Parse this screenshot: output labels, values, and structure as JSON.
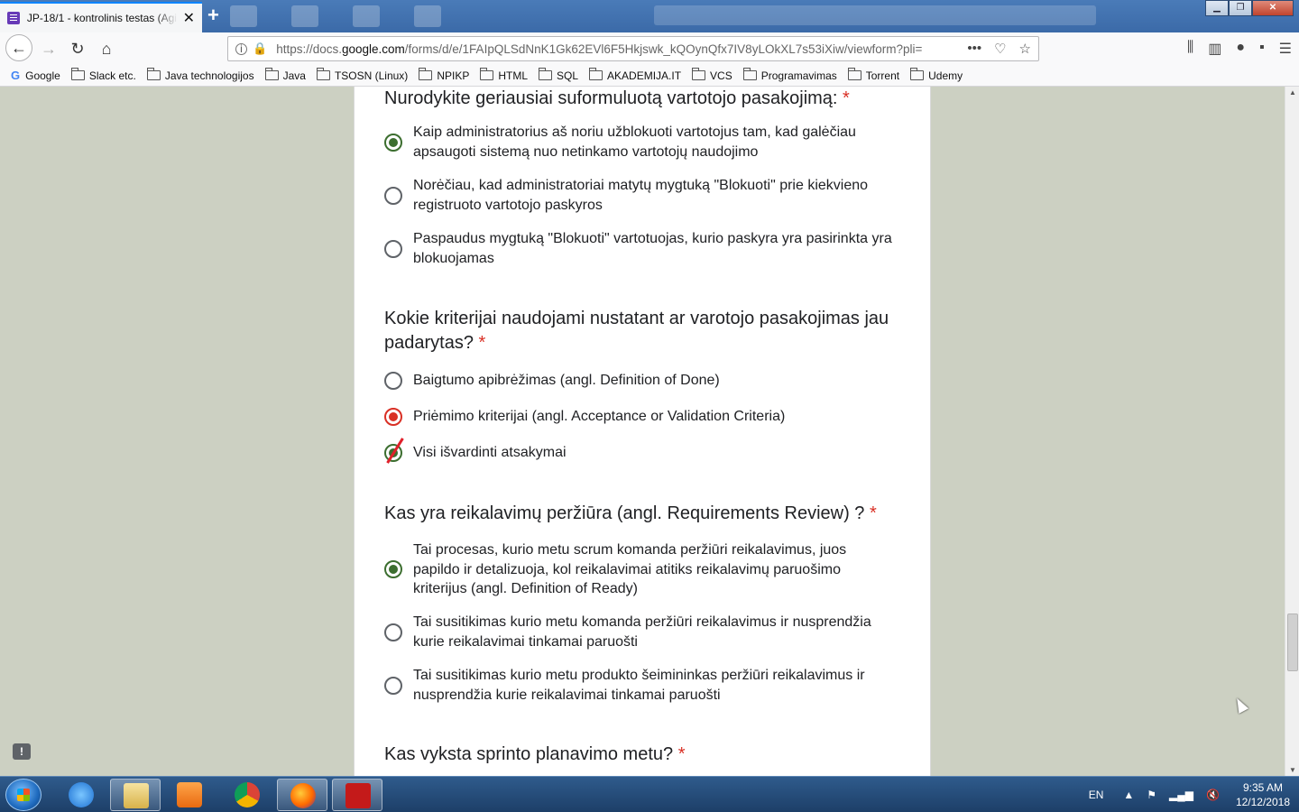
{
  "browser": {
    "tab_title": "JP-18/1 - kontrolinis testas (Agi",
    "url_prefix": "https://docs.",
    "url_host": "google.com",
    "url_path": "/forms/d/e/1FAIpQLSdNnK1Gk62EVl6F5Hkjswk_kQOynQfx7IV8yLOkXL7s53iXiw/viewform?pli=",
    "bookmarks": [
      "Google",
      "Slack etc.",
      "Java technologijos",
      "Java",
      "TSOSN (Linux)",
      "NPIKP",
      "HTML",
      "SQL",
      "AKADEMIJA.IT",
      "VCS",
      "Programavimas",
      "Torrent",
      "Udemy"
    ]
  },
  "form": {
    "required_mark": "*",
    "questions": [
      {
        "title": "Nurodykite geriausiai suformuluotą vartotojo pasakojimą:",
        "options": [
          {
            "line1": "Kaip administratorius aš noriu užblokuoti vartotojus tam, kad galėčiau",
            "line2": "apsaugoti sistemą nuo netinkamo vartotojų naudojimo",
            "state": "selected"
          },
          {
            "line1": "Norėčiau, kad administratoriai matytų mygtuką \"Blokuoti\" prie kiekvieno",
            "line2": "registruoto vartotojo paskyros",
            "state": "unselected"
          },
          {
            "line1": "Paspaudus mygtuką \"Blokuoti\" vartotuojas, kurio paskyra yra pasirinkta yra",
            "line2": "blokuojamas",
            "state": "unselected"
          }
        ]
      },
      {
        "title_line1": "Kokie kriterijai naudojami nustatant ar varotojo pasakojimas jau",
        "title_line2": "padarytas?",
        "options": [
          {
            "line1": "Baigtumo apibrėžimas (angl. Definition of Done)",
            "state": "unselected"
          },
          {
            "line1": "Priėmimo kriterijai (angl. Acceptance or Validation Criteria)",
            "state": "selected-red"
          },
          {
            "line1": "Visi išvardinti atsakymai",
            "state": "selected-struck"
          }
        ]
      },
      {
        "title": "Kas yra reikalavimų peržiūra (angl. Requirements Review) ?",
        "options": [
          {
            "line1": "Tai procesas, kurio metu scrum komanda peržiūri reikalavimus, juos",
            "line2": "papildo ir detalizuoja, kol reikalavimai atitiks reikalavimų paruošimo",
            "line3": "kriterijus (angl. Definition of Ready)",
            "state": "selected"
          },
          {
            "line1": "Tai susitikimas kurio metu komanda peržiūri reikalavimus ir nusprendžia",
            "line2": "kurie reikalavimai tinkamai paruošti",
            "state": "unselected"
          },
          {
            "line1": "Tai susitikimas kurio metu produkto šeimininkas peržiūri reikalavimus ir",
            "line2": "nusprendžia kurie reikalavimai tinkamai paruošti",
            "state": "unselected"
          }
        ]
      },
      {
        "title": "Kas vyksta sprinto planavimo metu?"
      }
    ]
  },
  "taskbar": {
    "lang": "EN",
    "time": "9:35 AM",
    "date": "12/12/2018"
  },
  "colors": {
    "selected_radio": "#3c6e2f",
    "wrong_radio": "#d93025",
    "required": "#d93025",
    "page_bg": "#ccd0c2"
  }
}
